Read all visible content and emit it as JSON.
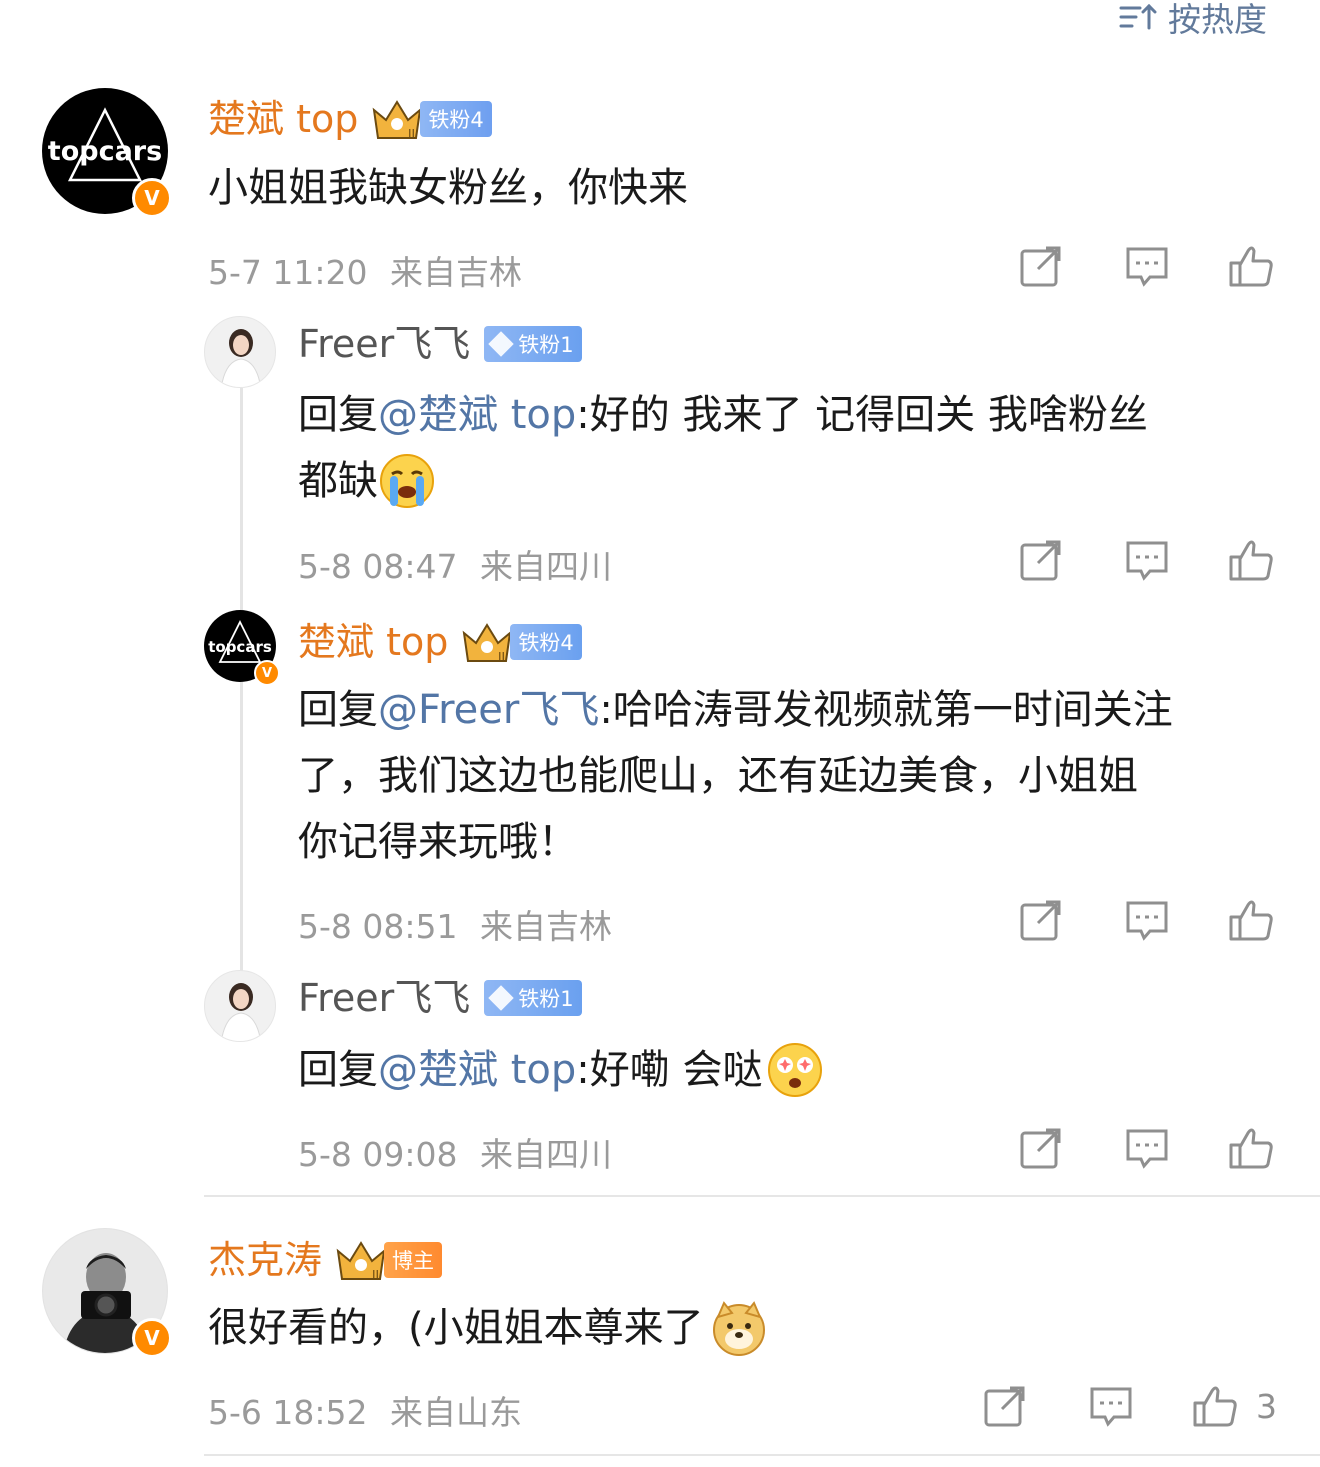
{
  "sort": {
    "label": "按热度",
    "icon": "sort-lines-icon"
  },
  "colors": {
    "name": "#e4781e",
    "mention": "#5376a6",
    "meta": "#9a9a9a",
    "verified": "#ff8a00"
  },
  "comments": [
    {
      "author": "楚斌 top",
      "avatar_text": "topcars",
      "badge": "铁粉4",
      "text": "小姐姐我缺女粉丝，你快来",
      "time": "5-7 11:20",
      "location": "来自吉林",
      "replies": [
        {
          "author": "Freer飞飞",
          "badge": "铁粉1",
          "prefix": "回复",
          "mention": "@楚斌 top",
          "line1": ":好的 我来了  记得回关 我啥粉丝",
          "line2": "都缺",
          "emoji": "crying-face-icon",
          "time": "5-8 08:47",
          "location": "来自四川"
        },
        {
          "author": "楚斌 top",
          "avatar_text": "topcars",
          "badge": "铁粉4",
          "prefix": "回复",
          "mention": "@Freer飞飞",
          "line1": ":哈哈涛哥发视频就第一时间关注",
          "line2": "了，我们这边也能爬山，还有延边美食，小姐姐",
          "line3": "你记得来玩哦！",
          "time": "5-8 08:51",
          "location": "来自吉林"
        },
        {
          "author": "Freer飞飞",
          "badge": "铁粉1",
          "prefix": "回复",
          "mention": "@楚斌 top",
          "line1": ":好嘞 会哒",
          "emoji": "starry-eyes-face-icon",
          "time": "5-8 09:08",
          "location": "来自四川"
        }
      ]
    },
    {
      "author": "杰克涛",
      "badge": "博主",
      "text": "很好看的，(小姐姐本尊来了",
      "emoji": "doge-icon",
      "time": "5-6 18:52",
      "location": "来自山东",
      "likes": "3"
    }
  ]
}
